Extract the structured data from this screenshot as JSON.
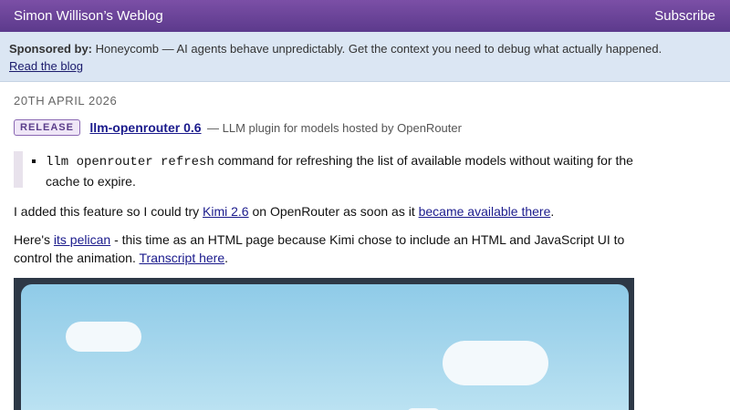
{
  "header": {
    "site_title": "Simon Willison’s Weblog",
    "subscribe_label": "Subscribe"
  },
  "sponsor": {
    "label": "Sponsored by:",
    "text": "Honeycomb — AI agents behave unpredictably. Get the context you need to debug what actually happened.",
    "link_label": "Read the blog"
  },
  "post": {
    "date": "20TH APRIL 2026",
    "badge": "RELEASE",
    "release_title": "llm-openrouter 0.6",
    "release_desc": "— LLM plugin for models hosted by OpenRouter",
    "quote_code": "llm openrouter refresh",
    "quote_text": " command for refreshing the list of available models without waiting for the cache to expire.",
    "p1_a": "I added this feature so I could try ",
    "p1_link1": "Kimi 2.6",
    "p1_b": " on OpenRouter as soon as it ",
    "p1_link2": "became available there",
    "p1_c": ".",
    "p2_a": "Here's ",
    "p2_link1": "its pelican",
    "p2_b": " - this time as an HTML page because Kimi chose to include an HTML and JavaScript UI to control the animation. ",
    "p2_link2": "Transcript here",
    "p2_c": "."
  },
  "colors": {
    "header_bg": "#6a449a",
    "sponsor_bg": "#dbe6f3",
    "link": "#1a1a8c",
    "badge_border": "#8a68b3"
  }
}
